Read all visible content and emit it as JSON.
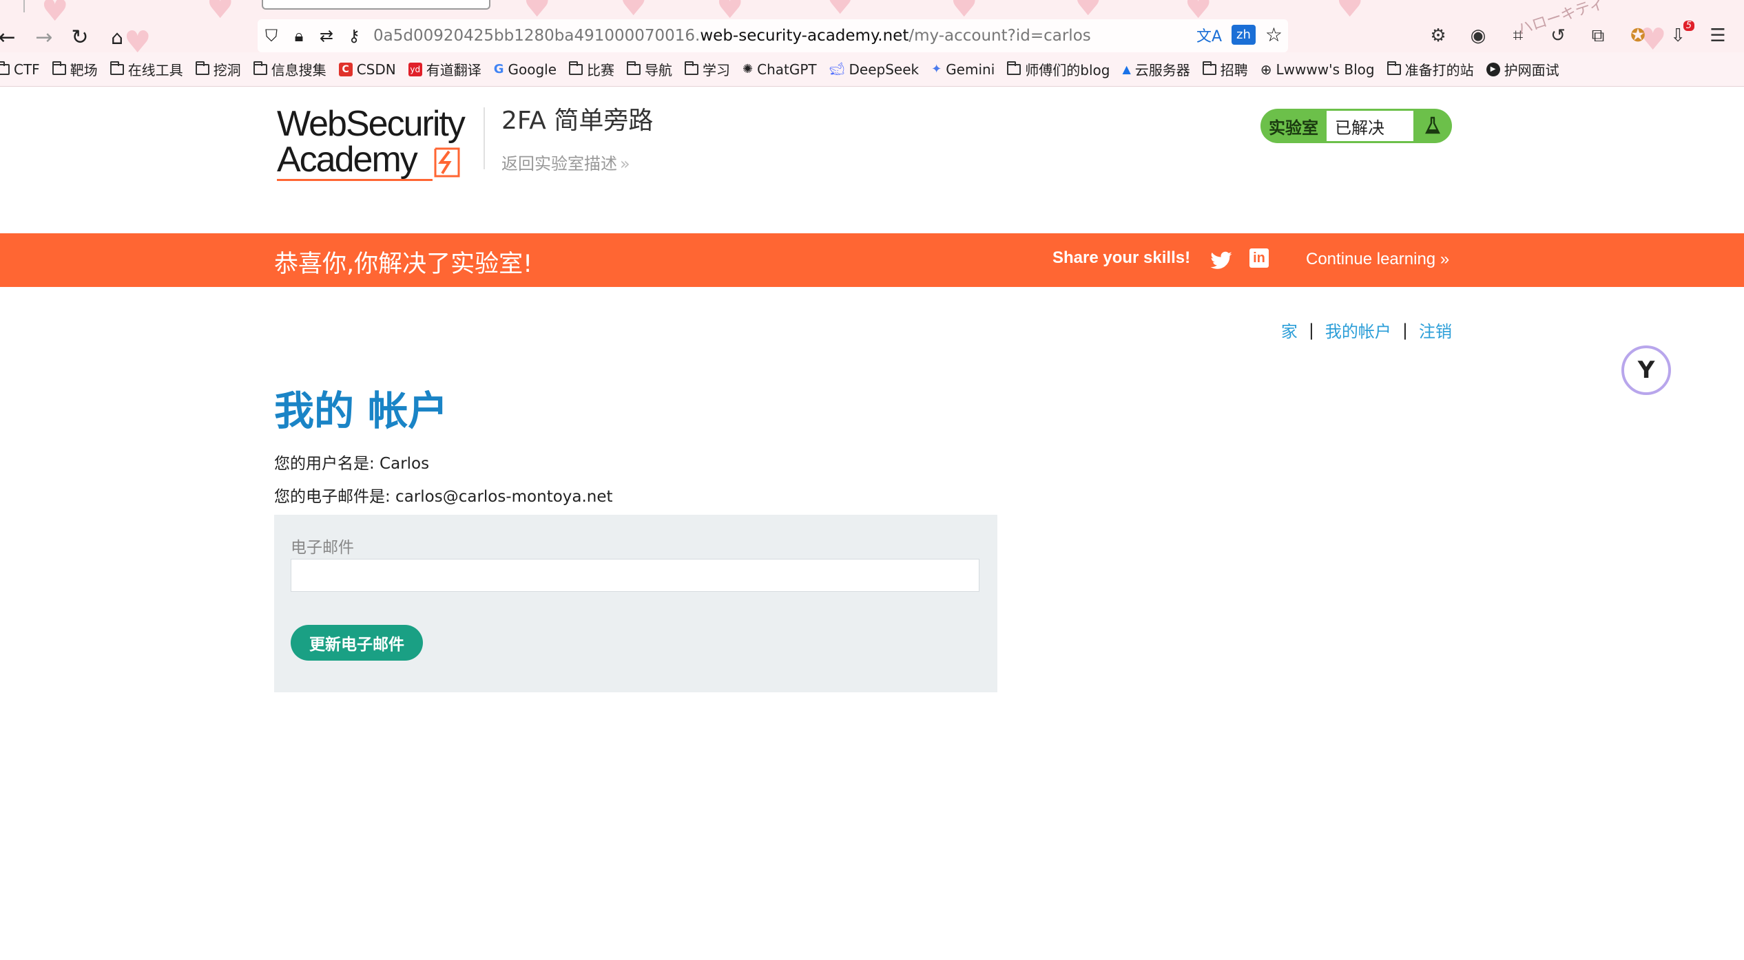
{
  "browser": {
    "url_prefix": "0a5d00920425bb1280ba491000070016.",
    "url_host": "web-security-academy.net",
    "url_path": "/my-account?id=carlos",
    "translate_label": "zh",
    "extension_badge_count": "5",
    "decor_text": "ハローキティ",
    "icons": {
      "back": "back-arrow-icon",
      "forward": "forward-arrow-icon",
      "reload": "reload-icon",
      "home": "home-icon",
      "shield": "shield-icon",
      "lock": "lock-icon",
      "permissions": "permissions-icon",
      "key": "key-icon",
      "translate": "translate-icon",
      "star": "bookmark-star-icon",
      "settings": "gear-icon",
      "profile": "profile-icon",
      "crop": "crop-icon",
      "history": "history-icon",
      "extensions": "puzzle-icon",
      "extension": "extension-icon",
      "menu": "hamburger-menu-icon"
    }
  },
  "bookmarks": [
    {
      "label": "CTF",
      "icon": "folder"
    },
    {
      "label": "靶场",
      "icon": "folder"
    },
    {
      "label": "在线工具",
      "icon": "folder"
    },
    {
      "label": "挖洞",
      "icon": "folder"
    },
    {
      "label": "信息搜集",
      "icon": "folder"
    },
    {
      "label": "CSDN",
      "icon": "csdn"
    },
    {
      "label": "有道翻译",
      "icon": "youdao"
    },
    {
      "label": "Google",
      "icon": "google"
    },
    {
      "label": "比赛",
      "icon": "folder"
    },
    {
      "label": "导航",
      "icon": "folder"
    },
    {
      "label": "学习",
      "icon": "folder"
    },
    {
      "label": "ChatGPT",
      "icon": "chatgpt"
    },
    {
      "label": "DeepSeek",
      "icon": "deepseek"
    },
    {
      "label": "Gemini",
      "icon": "gemini"
    },
    {
      "label": "师傅们的blog",
      "icon": "folder"
    },
    {
      "label": "云服务器",
      "icon": "cloud"
    },
    {
      "label": "招聘",
      "icon": "folder"
    },
    {
      "label": "Lwwww's Blog",
      "icon": "globe"
    },
    {
      "label": "准备打的站",
      "icon": "folder"
    },
    {
      "label": "护网面试",
      "icon": "play"
    }
  ],
  "header": {
    "logo_line1": "WebSecurity",
    "logo_line2": "Academy",
    "lab_title": "2FA 简单旁路",
    "back_link": "返回实验室描述",
    "back_chevron": "»",
    "status_label": "实验室",
    "status_value": "已解决",
    "status_icon": "flask-icon"
  },
  "banner": {
    "message": "恭喜你,你解决了实验室!",
    "share": "Share your skills!",
    "continue": "Continue learning",
    "continue_chevron": "»",
    "linkedin_glyph": "in",
    "color": "#ff6633"
  },
  "nav": {
    "home": "家",
    "account": "我的帐户",
    "logout": "注销",
    "separator": "|"
  },
  "main": {
    "title": "我的 帐户",
    "username_line": "您的用户名是: Carlos",
    "email_line": "您的电子邮件是: carlos@carlos-montoya.net",
    "form_label": "电子邮件",
    "email_value": "",
    "submit_label": "更新电子邮件"
  },
  "colors": {
    "title_blue": "#1a84c6",
    "link_blue": "#2b9ed8",
    "button_green": "#1aa084",
    "status_green": "#6cc04a"
  }
}
